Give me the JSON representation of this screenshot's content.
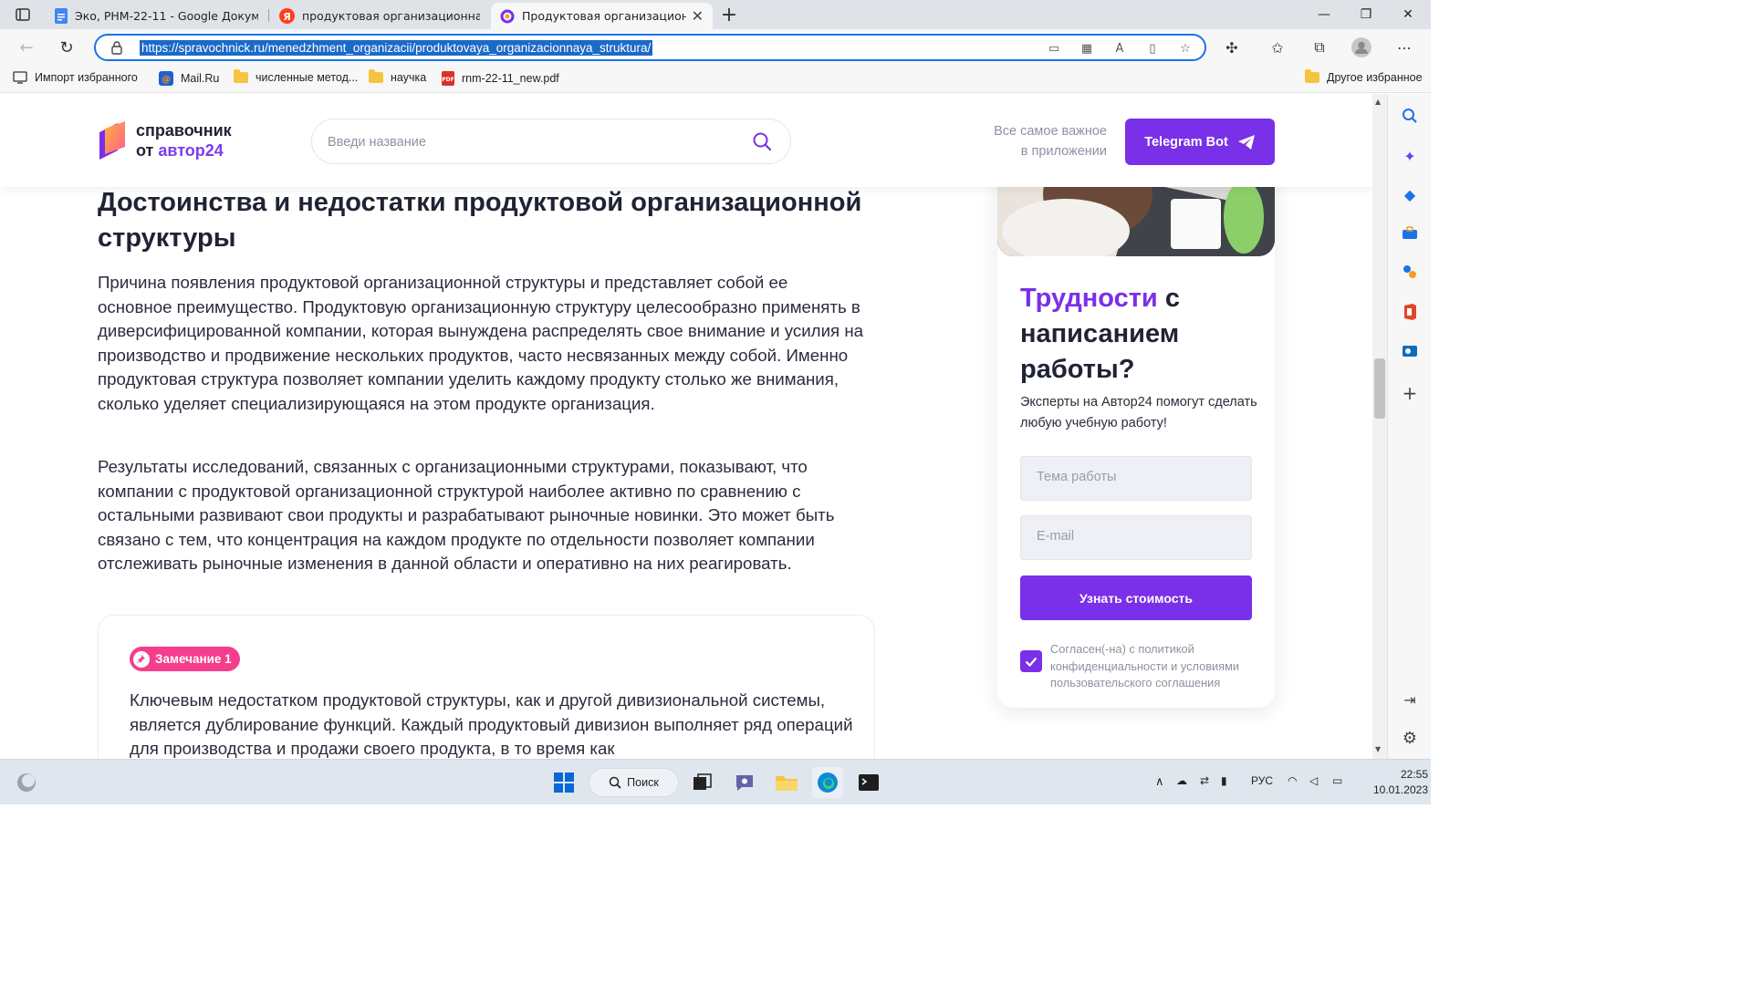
{
  "browser": {
    "tabs": [
      {
        "title": "Эко, РНМ-22-11 - Google Докум",
        "icon": "google-docs-icon"
      },
      {
        "title": "продуктовая организационная",
        "icon": "yandex-icon"
      },
      {
        "title": "Продуктовая организационная",
        "icon": "spravochnik-icon",
        "active": true
      }
    ],
    "url": "https://spravochnick.ru/menedzhment_organizacii/produktovaya_organizacionnaya_struktura/",
    "bookmarks": [
      {
        "label": "Импорт избранного",
        "icon": "import-icon"
      },
      {
        "label": "Mail.Ru",
        "icon": "mailru-icon"
      },
      {
        "label": "численные метод...",
        "icon": "folder-icon"
      },
      {
        "label": "научка",
        "icon": "folder-icon"
      },
      {
        "label": "rnm-22-11_new.pdf",
        "icon": "pdf-icon"
      }
    ],
    "other_favorites": "Другое избранное"
  },
  "site": {
    "logo_line1": "справочник",
    "logo_line2_prefix": "от ",
    "logo_line2_accent": "автор24",
    "search_placeholder": "Введи название",
    "app_promo_line1": "Все самое важное",
    "app_promo_line2": "в приложении",
    "telegram_button": "Telegram Bot",
    "colors": {
      "accent": "#7a2fe8",
      "badge": "#f53d8d",
      "text": "#1f2333"
    }
  },
  "article": {
    "heading": "Достоинства и недостатки продуктовой организационной структуры",
    "paragraph1": "Причина появления продуктовой организационной структуры и представляет собой ее основное преимущество. Продуктовую организационную структуру целесообразно применять в диверсифицированной компании, которая вынуждена распределять свое внимание и усилия на производство и продвижение нескольких продуктов, часто несвязанных между собой. Именно продуктовая структура позволяет компании уделить каждому продукту столько же внимания, сколько уделяет специализирующаяся на этом продукте организация.",
    "paragraph2": "Результаты исследований, связанных с организационными структурами, показывают, что компании с продуктовой организационной структурой наиболее активно по сравнению с остальными развивают свои продукты и разрабатывают рыночные новинки. Это может быть связано с тем, что концентрация на каждом продукте по отдельности позволяет компании отслеживать рыночные изменения в данной области и оперативно на них реагировать.",
    "note_badge": "Замечание 1",
    "note_text": "Ключевым недостатком продуктовой структуры, как и другой дивизиональной системы, является дублирование функций. Каждый продуктовый дивизион выполняет ряд операций для производства и продажи своего продукта, в то время как"
  },
  "promo": {
    "title_accent": "Трудности",
    "title_rest": " с написанием работы?",
    "subtitle": "Эксперты на Автор24 помогут сделать любую учебную работу!",
    "topic_placeholder": "Тема работы",
    "email_placeholder": "E-mail",
    "button": "Узнать стоимость",
    "consent": "Согласен(-на) с политикой конфиденциальности и условиями пользовательского соглашения",
    "consent_checked": true
  },
  "taskbar": {
    "search_label": "Поиск",
    "language": "РУС",
    "time": "22:55",
    "date": "10.01.2023"
  }
}
